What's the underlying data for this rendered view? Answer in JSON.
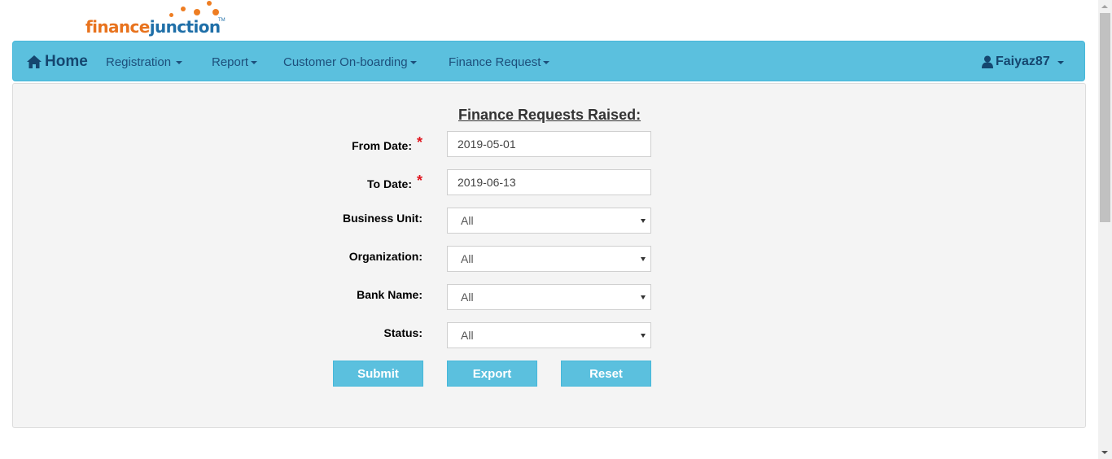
{
  "brand": {
    "part1": "finance",
    "part2": "junction",
    "tm": "TM",
    "accent": "#e8731e",
    "secondary": "#1f6fa8"
  },
  "navbar": {
    "color": "#5bc0de",
    "home": {
      "label": "Home",
      "icon": "home-icon"
    },
    "items": [
      {
        "label": "Registration"
      },
      {
        "label": "Report"
      },
      {
        "label": "Customer On-boarding"
      },
      {
        "label": "Finance Request"
      }
    ],
    "user": {
      "label": "Faiyaz87",
      "icon": "user-icon"
    }
  },
  "form": {
    "title": "Finance Requests Raised:",
    "from_date": {
      "label": "From Date:",
      "required": "*",
      "value": "2019-05-01"
    },
    "to_date": {
      "label": "To Date:",
      "required": "*",
      "value": "2019-06-13"
    },
    "business_unit": {
      "label": "Business Unit:",
      "selected": "All"
    },
    "organization": {
      "label": "Organization:",
      "selected": "All"
    },
    "bank_name": {
      "label": "Bank Name:",
      "selected": "All"
    },
    "status": {
      "label": "Status:",
      "selected": "All"
    },
    "buttons": {
      "submit": "Submit",
      "export": "Export",
      "reset": "Reset"
    }
  }
}
